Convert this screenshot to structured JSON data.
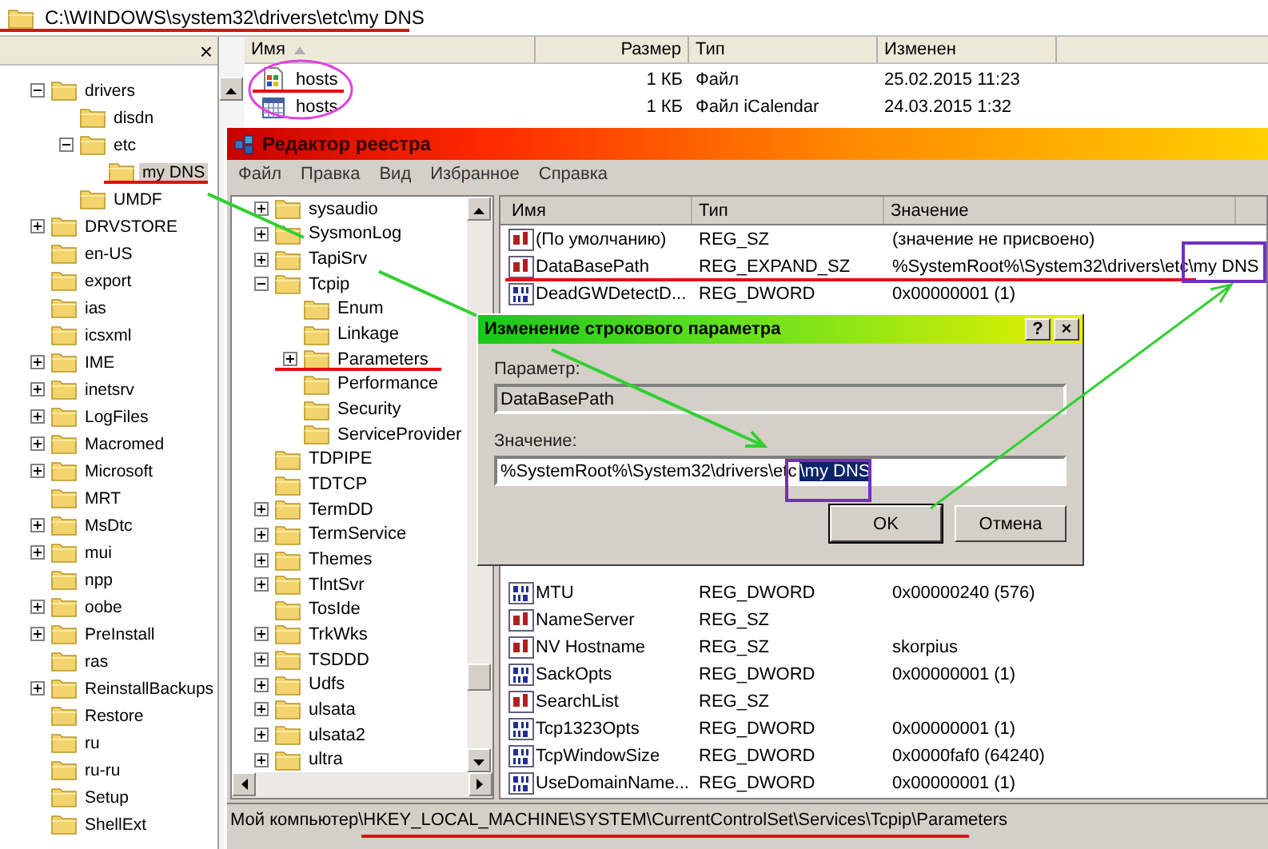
{
  "address_bar": {
    "path": "C:\\WINDOWS\\system32\\drivers\\etc\\my DNS"
  },
  "folder_pane": {
    "close": "×",
    "tree": [
      {
        "label": "drivers",
        "expanded": true,
        "selected": false,
        "children": [
          {
            "label": "disdn",
            "selected": false
          },
          {
            "label": "etc",
            "expanded": true,
            "selected": false,
            "children": [
              {
                "label": "my DNS",
                "selected": true
              }
            ]
          },
          {
            "label": "UMDF",
            "selected": false
          }
        ]
      },
      {
        "label": "DRVSTORE",
        "expanded": false,
        "selected": false
      },
      {
        "label": "en-US",
        "selected": false
      },
      {
        "label": "export",
        "selected": false
      },
      {
        "label": "ias",
        "selected": false
      },
      {
        "label": "icsxml",
        "selected": false
      },
      {
        "label": "IME",
        "expanded": false,
        "selected": false
      },
      {
        "label": "inetsrv",
        "expanded": false,
        "selected": false
      },
      {
        "label": "LogFiles",
        "expanded": false,
        "selected": false
      },
      {
        "label": "Macromed",
        "expanded": false,
        "selected": false
      },
      {
        "label": "Microsoft",
        "expanded": false,
        "selected": false
      },
      {
        "label": "MRT",
        "selected": false
      },
      {
        "label": "MsDtc",
        "expanded": false,
        "selected": false
      },
      {
        "label": "mui",
        "expanded": false,
        "selected": false
      },
      {
        "label": "npp",
        "selected": false
      },
      {
        "label": "oobe",
        "expanded": false,
        "selected": false
      },
      {
        "label": "PreInstall",
        "expanded": false,
        "selected": false
      },
      {
        "label": "ras",
        "selected": false
      },
      {
        "label": "ReinstallBackups",
        "expanded": false,
        "selected": false
      },
      {
        "label": "Restore",
        "selected": false
      },
      {
        "label": "ru",
        "selected": false
      },
      {
        "label": "ru-ru",
        "selected": false
      },
      {
        "label": "Setup",
        "selected": false
      },
      {
        "label": "ShellExt",
        "selected": false
      }
    ]
  },
  "file_list": {
    "columns": [
      "Имя",
      "Размер",
      "Тип",
      "Изменен"
    ],
    "rows": [
      {
        "kind": "file",
        "name": "hosts",
        "size": "1 КБ",
        "type": "Файл",
        "modified": "25.02.2015 11:23"
      },
      {
        "kind": "calendar",
        "name": "hosts",
        "size": "1 КБ",
        "type": "Файл iCalendar",
        "modified": "24.03.2015 1:32"
      }
    ]
  },
  "registry_editor": {
    "title": "Редактор реестра",
    "menu": [
      "Файл",
      "Правка",
      "Вид",
      "Избранное",
      "Справка"
    ],
    "tree": [
      {
        "label": "sysaudio",
        "expanded": false
      },
      {
        "label": "SysmonLog",
        "expanded": false
      },
      {
        "label": "TapiSrv",
        "expanded": false
      },
      {
        "label": "Tcpip",
        "expanded": true,
        "children": [
          {
            "label": "Enum"
          },
          {
            "label": "Linkage"
          },
          {
            "label": "Parameters",
            "expanded": false
          },
          {
            "label": "Performance"
          },
          {
            "label": "Security"
          },
          {
            "label": "ServiceProvider"
          }
        ]
      },
      {
        "label": "TDPIPE"
      },
      {
        "label": "TDTCP"
      },
      {
        "label": "TermDD",
        "expanded": false
      },
      {
        "label": "TermService",
        "expanded": false
      },
      {
        "label": "Themes",
        "expanded": false
      },
      {
        "label": "TlntSvr",
        "expanded": false
      },
      {
        "label": "TosIde"
      },
      {
        "label": "TrkWks",
        "expanded": false
      },
      {
        "label": "TSDDD",
        "expanded": false
      },
      {
        "label": "Udfs",
        "expanded": false
      },
      {
        "label": "ulsata",
        "expanded": false
      },
      {
        "label": "ulsata2",
        "expanded": false
      },
      {
        "label": "ultra",
        "expanded": false
      }
    ],
    "columns": [
      "Имя",
      "Тип",
      "Значение"
    ],
    "values": [
      {
        "kind": "string",
        "name": "(По умолчанию)",
        "type": "REG_SZ",
        "data": "(значение не присвоено)"
      },
      {
        "kind": "string",
        "name": "DataBasePath",
        "type": "REG_EXPAND_SZ",
        "data": "%SystemRoot%\\System32\\drivers\\etc\\my DNS"
      },
      {
        "kind": "dword",
        "name": "DeadGWDetectD...",
        "type": "REG_DWORD",
        "data": "0x00000001 (1)"
      }
    ],
    "values_below_dialog": [
      {
        "kind": "dword",
        "name": "MTU",
        "type": "REG_DWORD",
        "data": "0x00000240 (576)"
      },
      {
        "kind": "string",
        "name": "NameServer",
        "type": "REG_SZ"
      },
      {
        "kind": "string",
        "name": "NV Hostname",
        "type": "REG_SZ",
        "data": "skorpius"
      },
      {
        "kind": "dword",
        "name": "SackOpts",
        "type": "REG_DWORD",
        "data": "0x00000001 (1)"
      },
      {
        "kind": "string",
        "name": "SearchList",
        "type": "REG_SZ"
      },
      {
        "kind": "dword",
        "name": "Tcp1323Opts",
        "type": "REG_DWORD",
        "data": "0x00000001 (1)"
      },
      {
        "kind": "dword",
        "name": "TcpWindowSize",
        "type": "REG_DWORD",
        "data": "0x0000faf0 (64240)"
      },
      {
        "kind": "dword",
        "name": "UseDomainName...",
        "type": "REG_DWORD",
        "data": "0x00000001 (1)"
      }
    ],
    "status_bar": "Мой компьютер\\HKEY_LOCAL_MACHINE\\SYSTEM\\CurrentControlSet\\Services\\Tcpip\\Parameters"
  },
  "dialog": {
    "title": "Изменение строкового параметра",
    "help": "?",
    "close": "×",
    "name_label": "Параметр:",
    "name_value": "DataBasePath",
    "value_label": "Значение:",
    "value": "%SystemRoot%\\System32\\drivers\\etc",
    "selected_text": "\\my DNS",
    "buttons": [
      {
        "label": "OK",
        "default": true
      },
      {
        "label": "Отмена",
        "default": false
      }
    ]
  }
}
